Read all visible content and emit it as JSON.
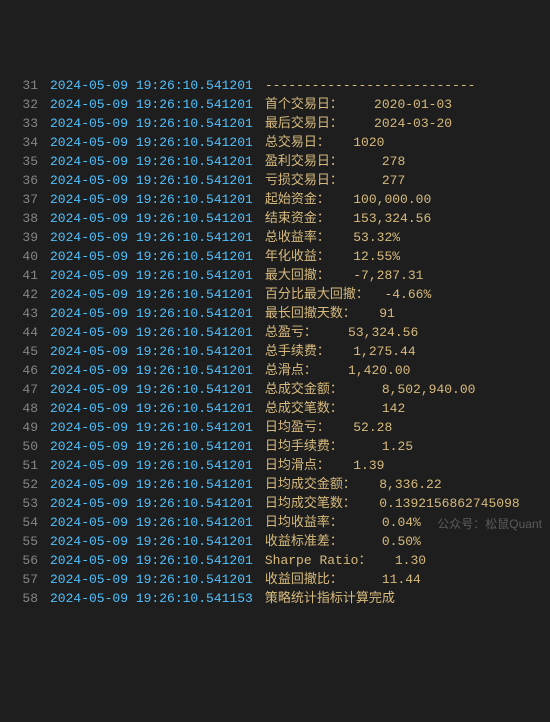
{
  "lines": [
    {
      "n": "31",
      "ts": "2024-05-09 19:26:10.541201",
      "msg": "---------------------------"
    },
    {
      "n": "32",
      "ts": "2024-05-09 19:26:10.541201",
      "msg": "首个交易日：    2020-01-03"
    },
    {
      "n": "33",
      "ts": "2024-05-09 19:26:10.541201",
      "msg": "最后交易日：    2024-03-20"
    },
    {
      "n": "34",
      "ts": "2024-05-09 19:26:10.541201",
      "msg": "总交易日：   1020"
    },
    {
      "n": "35",
      "ts": "2024-05-09 19:26:10.541201",
      "msg": "盈利交易日：     278"
    },
    {
      "n": "36",
      "ts": "2024-05-09 19:26:10.541201",
      "msg": "亏损交易日：     277"
    },
    {
      "n": "37",
      "ts": "2024-05-09 19:26:10.541201",
      "msg": "起始资金：   100,000.00"
    },
    {
      "n": "38",
      "ts": "2024-05-09 19:26:10.541201",
      "msg": "结束资金：   153,324.56"
    },
    {
      "n": "39",
      "ts": "2024-05-09 19:26:10.541201",
      "msg": "总收益率：   53.32%"
    },
    {
      "n": "40",
      "ts": "2024-05-09 19:26:10.541201",
      "msg": "年化收益：   12.55%"
    },
    {
      "n": "41",
      "ts": "2024-05-09 19:26:10.541201",
      "msg": "最大回撤：   -7,287.31"
    },
    {
      "n": "42",
      "ts": "2024-05-09 19:26:10.541201",
      "msg": "百分比最大回撤：  -4.66%"
    },
    {
      "n": "43",
      "ts": "2024-05-09 19:26:10.541201",
      "msg": "最长回撤天数：   91"
    },
    {
      "n": "44",
      "ts": "2024-05-09 19:26:10.541201",
      "msg": "总盈亏：    53,324.56"
    },
    {
      "n": "45",
      "ts": "2024-05-09 19:26:10.541201",
      "msg": "总手续费：   1,275.44"
    },
    {
      "n": "46",
      "ts": "2024-05-09 19:26:10.541201",
      "msg": "总滑点：    1,420.00"
    },
    {
      "n": "47",
      "ts": "2024-05-09 19:26:10.541201",
      "msg": "总成交金额：     8,502,940.00"
    },
    {
      "n": "48",
      "ts": "2024-05-09 19:26:10.541201",
      "msg": "总成交笔数：     142"
    },
    {
      "n": "49",
      "ts": "2024-05-09 19:26:10.541201",
      "msg": "日均盈亏：   52.28"
    },
    {
      "n": "50",
      "ts": "2024-05-09 19:26:10.541201",
      "msg": "日均手续费：     1.25"
    },
    {
      "n": "51",
      "ts": "2024-05-09 19:26:10.541201",
      "msg": "日均滑点：   1.39"
    },
    {
      "n": "52",
      "ts": "2024-05-09 19:26:10.541201",
      "msg": "日均成交金额：   8,336.22"
    },
    {
      "n": "53",
      "ts": "2024-05-09 19:26:10.541201",
      "msg": "日均成交笔数：   0.1392156862745098"
    },
    {
      "n": "54",
      "ts": "2024-05-09 19:26:10.541201",
      "msg": "日均收益率：     0.04%"
    },
    {
      "n": "55",
      "ts": "2024-05-09 19:26:10.541201",
      "msg": "收益标准差：     0.50%"
    },
    {
      "n": "56",
      "ts": "2024-05-09 19:26:10.541201",
      "msg": "Sharpe Ratio：   1.30"
    },
    {
      "n": "57",
      "ts": "2024-05-09 19:26:10.541201",
      "msg": "收益回撤比：     11.44"
    },
    {
      "n": "58",
      "ts": "2024-05-09 19:26:10.541153",
      "msg": "策略统计指标计算完成"
    }
  ],
  "watermark": "公众号：松鼠Quant"
}
